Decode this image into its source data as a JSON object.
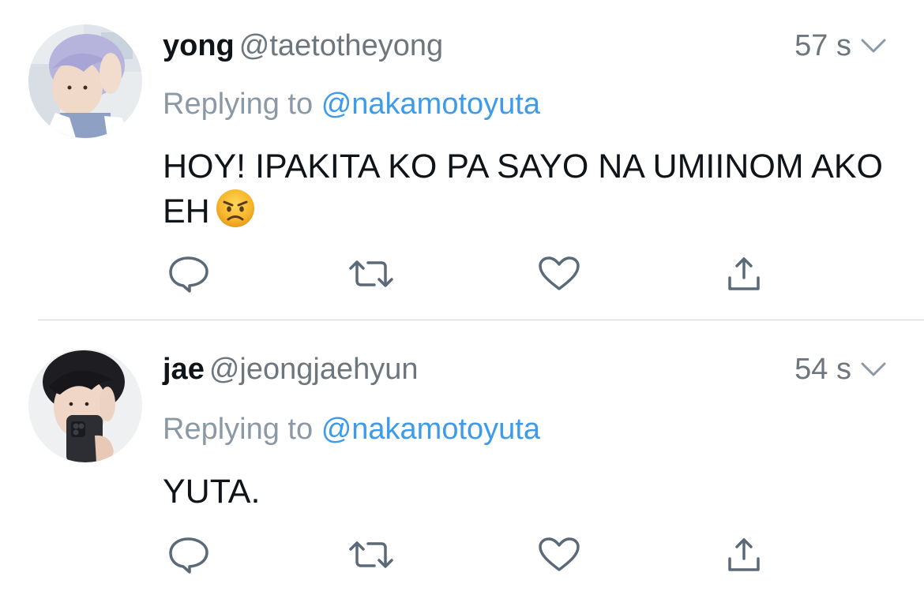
{
  "tweets": [
    {
      "display_name": "yong",
      "handle": "@taetotheyong",
      "time": "57 s",
      "replying_label": "Replying to",
      "replying_to": "@nakamotoyuta",
      "text": "HOY! IPAKITA KO PA SAYO NA UMIINOM AKO EH",
      "emoji": "angry-face-emoji"
    },
    {
      "display_name": "jae",
      "handle": "@jeongjaehyun",
      "time": "54 s",
      "replying_label": "Replying to",
      "replying_to": "@nakamotoyuta",
      "text": "YUTA."
    }
  ],
  "icons": {
    "reply": "reply-icon",
    "retweet": "retweet-icon",
    "like": "like-icon",
    "share": "share-icon",
    "menu": "chevron-down-icon"
  },
  "colors": {
    "text": "#0f1419",
    "secondary": "#6e767d",
    "link": "#3d9be9",
    "icon": "#5b6a78",
    "divider": "#d4d7da"
  }
}
